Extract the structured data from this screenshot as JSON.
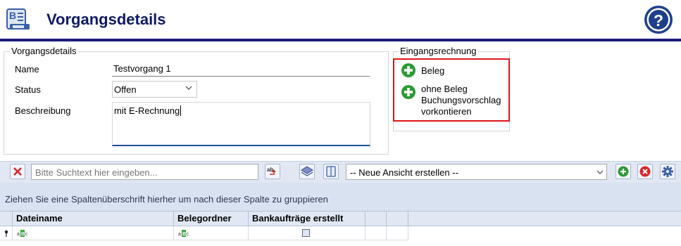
{
  "header": {
    "title": "Vorgangsdetails",
    "help_symbol": "?",
    "accent_color": "#1c1c7c",
    "title_color": "#0e1a66"
  },
  "details": {
    "group_title": "Vorgangsdetails",
    "name_label": "Name",
    "name_value": "Testvorgang 1",
    "status_label": "Status",
    "status_value": "Offen",
    "description_label": "Beschreibung",
    "description_value": "mit E-Rechnung"
  },
  "invoice": {
    "group_title": "Eingangsrechnung",
    "highlight_color": "#e0151b",
    "icon_color": "#2e9a37",
    "actions": [
      {
        "label": "Beleg"
      },
      {
        "label_lines": [
          "ohne Beleg",
          "Buchungsvorschlag",
          "vorkontieren"
        ]
      }
    ]
  },
  "toolbar": {
    "search_placeholder": "Bitte Suchtext hier eingeben...",
    "view_select_value": "-- Neue Ansicht erstellen --"
  },
  "grid": {
    "group_hint": "Ziehen Sie eine Spaltenüberschrift hierher um nach dieser Spalte zu gruppieren",
    "columns": [
      "Dateiname",
      "Belegordner",
      "Bankaufträge erstellt",
      "",
      ""
    ]
  },
  "icons": {
    "header": "document-list-icon",
    "help": "question-mark-icon",
    "add": "plus-circle-icon",
    "clear": "x-icon",
    "spell": "spellcheck-icon",
    "view1": "layers-icon",
    "view2": "book-icon",
    "remove": "x-circle-icon",
    "settings": "gear-icon",
    "filter_text": "text-filter-icon",
    "filter_pin": "pin-icon"
  }
}
